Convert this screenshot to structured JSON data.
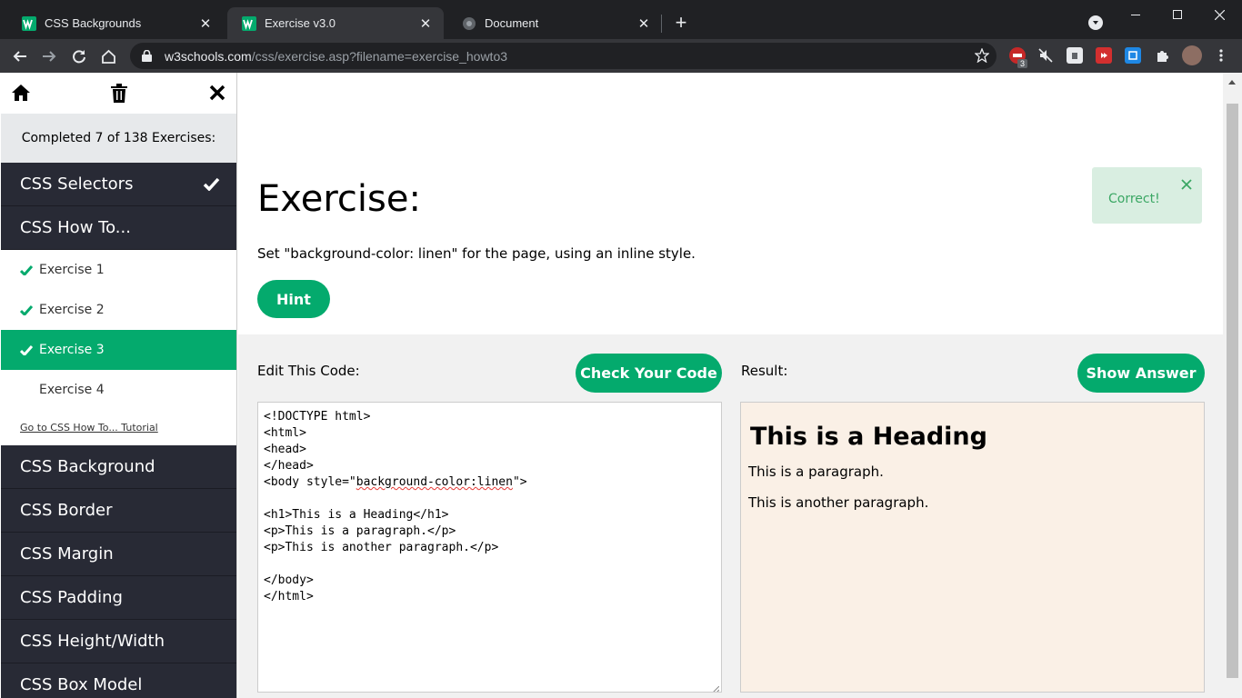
{
  "browser": {
    "tabs": [
      {
        "title": "CSS Backgrounds",
        "active": false
      },
      {
        "title": "Exercise v3.0",
        "active": true
      },
      {
        "title": "Document",
        "active": false
      }
    ],
    "url_host": "w3schools.com",
    "url_path": "/css/exercise.asp?filename=exercise_howto3",
    "ext_badge": "3"
  },
  "sidebar": {
    "progress": "Completed 7 of 138 Exercises:",
    "sections": [
      {
        "label": "CSS Selectors"
      },
      {
        "label": "CSS How To..."
      }
    ],
    "exercises": [
      {
        "label": "Exercise 1"
      },
      {
        "label": "Exercise 2"
      },
      {
        "label": "Exercise 3"
      },
      {
        "label": "Exercise 4"
      }
    ],
    "tutorial_link": "Go to CSS How To... Tutorial",
    "more_sections": [
      {
        "label": "CSS Background"
      },
      {
        "label": "CSS Border"
      },
      {
        "label": "CSS Margin"
      },
      {
        "label": "CSS Padding"
      },
      {
        "label": "CSS Height/Width"
      },
      {
        "label": "CSS Box Model"
      }
    ]
  },
  "main": {
    "title": "Exercise:",
    "description": "Set \"background-color: linen\" for the page, using an inline style.",
    "hint_label": "Hint",
    "correct_message": "Correct!",
    "edit_label": "Edit This Code:",
    "check_label": "Check Your Code",
    "result_label": "Result:",
    "show_answer_label": "Show Answer",
    "code": {
      "line1": "<!DOCTYPE html>",
      "line2": "<html>",
      "line3": "<head>",
      "line4": "</head>",
      "line5_pre": "<body style=\"",
      "line5_squig": "background-color:linen",
      "line5_post": "\">",
      "line7": "<h1>This is a Heading</h1>",
      "line8": "<p>This is a paragraph.</p>",
      "line9": "<p>This is another paragraph.</p>",
      "line11": "</body>",
      "line12": "</html>"
    },
    "result": {
      "heading": "This is a Heading",
      "p1": "This is a paragraph.",
      "p2": "This is another paragraph."
    }
  },
  "colors": {
    "accent": "#04aa6d",
    "sidebar_bg": "#282a35",
    "result_bg": "#faf0e6"
  }
}
